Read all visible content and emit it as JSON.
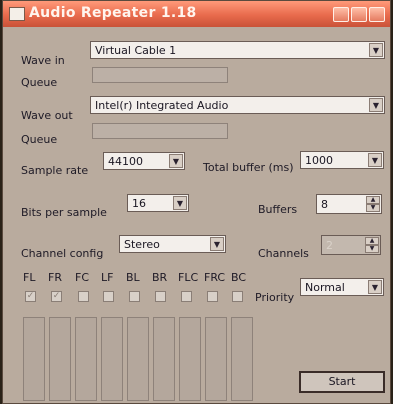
{
  "window": {
    "title": "Audio Repeater 1.18"
  },
  "wave_in": {
    "label": "Wave in",
    "value": "Virtual Cable 1",
    "queue_label": "Queue"
  },
  "wave_out": {
    "label": "Wave out",
    "value": "Intel(r) Integrated Audio",
    "queue_label": "Queue"
  },
  "sample_rate": {
    "label": "Sample rate",
    "value": "44100"
  },
  "total_buffer": {
    "label": "Total buffer (ms)",
    "value": "1000"
  },
  "bits_per_sample": {
    "label": "Bits per sample",
    "value": "16"
  },
  "buffers": {
    "label": "Buffers",
    "value": "8"
  },
  "channel_config": {
    "label": "Channel config",
    "value": "Stereo"
  },
  "channels": {
    "label": "Channels",
    "value": "2"
  },
  "channel_labels": [
    "FL",
    "FR",
    "FC",
    "LF",
    "BL",
    "BR",
    "FLC",
    "FRC",
    "BC"
  ],
  "channel_checked": [
    true,
    true,
    false,
    false,
    false,
    false,
    false,
    false,
    false
  ],
  "priority": {
    "label": "Priority",
    "value": "Normal"
  },
  "start_button": "Start",
  "icons": {
    "dropdown": "chevron-down-icon",
    "spin_up": "arrow-up-icon",
    "spin_down": "arrow-down-icon",
    "check": "check-icon"
  }
}
